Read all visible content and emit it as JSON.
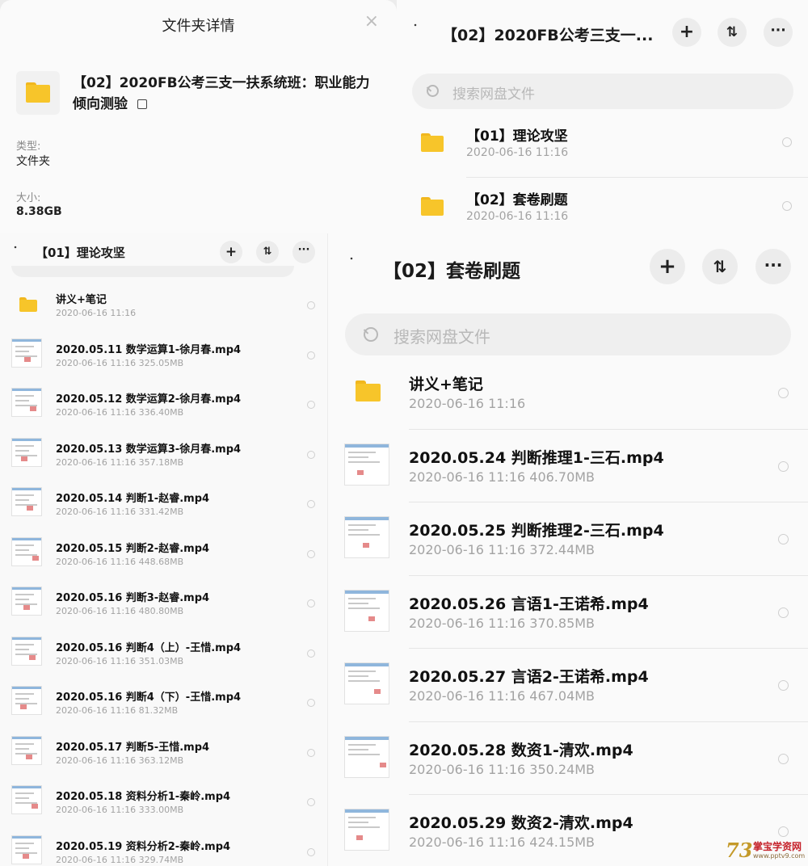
{
  "details": {
    "title": "文件夹详情",
    "close_icon": "close-icon",
    "folder_name": "【02】2020FB公考三支一扶系统班：职业能力倾向测验",
    "type_label": "类型:",
    "type_value": "文件夹",
    "size_label": "大小:",
    "size_value": "8.38GB"
  },
  "root_panel": {
    "title": "【02】2020FB公考三支一...",
    "search_placeholder": "搜索网盘文件",
    "add_label": "+",
    "sort_label": "⇅",
    "more_label": "···",
    "items": [
      {
        "name": "【01】理论攻坚",
        "meta": "2020-06-16  11:16"
      },
      {
        "name": "【02】套卷刷题",
        "meta": "2020-06-16  11:16"
      }
    ]
  },
  "left_panel": {
    "title": "【01】理论攻坚",
    "add_label": "+",
    "sort_label": "⇅",
    "more_label": "···",
    "items": [
      {
        "name": "讲义+笔记",
        "meta": "2020-06-16  11:16",
        "kind": "folder"
      },
      {
        "name": "2020.05.11 数学运算1-徐月春.mp4",
        "meta": "2020-06-16  11:16  325.05MB",
        "kind": "video"
      },
      {
        "name": "2020.05.12 数学运算2-徐月春.mp4",
        "meta": "2020-06-16  11:16  336.40MB",
        "kind": "video"
      },
      {
        "name": "2020.05.13 数学运算3-徐月春.mp4",
        "meta": "2020-06-16  11:16  357.18MB",
        "kind": "video"
      },
      {
        "name": "2020.05.14 判断1-赵睿.mp4",
        "meta": "2020-06-16  11:16  331.42MB",
        "kind": "video"
      },
      {
        "name": "2020.05.15 判断2-赵睿.mp4",
        "meta": "2020-06-16  11:16  448.68MB",
        "kind": "video"
      },
      {
        "name": "2020.05.16 判断3-赵睿.mp4",
        "meta": "2020-06-16  11:16  480.80MB",
        "kind": "video"
      },
      {
        "name": "2020.05.16 判断4（上）-王惜.mp4",
        "meta": "2020-06-16  11:16  351.03MB",
        "kind": "video"
      },
      {
        "name": "2020.05.16 判断4（下）-王惜.mp4",
        "meta": "2020-06-16  11:16  81.32MB",
        "kind": "video"
      },
      {
        "name": "2020.05.17 判断5-王惜.mp4",
        "meta": "2020-06-16  11:16  363.12MB",
        "kind": "video"
      },
      {
        "name": "2020.05.18 资料分析1-秦岭.mp4",
        "meta": "2020-06-16  11:16  333.00MB",
        "kind": "video"
      },
      {
        "name": "2020.05.19 资料分析2-秦岭.mp4",
        "meta": "2020-06-16  11:16  329.74MB",
        "kind": "video"
      }
    ]
  },
  "right_panel": {
    "title": "【02】套卷刷题",
    "search_placeholder": "搜索网盘文件",
    "add_label": "+",
    "sort_label": "⇅",
    "more_label": "···",
    "items": [
      {
        "name": "讲义+笔记",
        "meta": "2020-06-16  11:16",
        "kind": "folder"
      },
      {
        "name": "2020.05.24 判断推理1-三石.mp4",
        "meta": "2020-06-16  11:16  406.70MB",
        "kind": "video"
      },
      {
        "name": "2020.05.25 判断推理2-三石.mp4",
        "meta": "2020-06-16  11:16  372.44MB",
        "kind": "video"
      },
      {
        "name": "2020.05.26 言语1-王诺希.mp4",
        "meta": "2020-06-16  11:16  370.85MB",
        "kind": "video"
      },
      {
        "name": "2020.05.27 言语2-王诺希.mp4",
        "meta": "2020-06-16  11:16  467.04MB",
        "kind": "video"
      },
      {
        "name": "2020.05.28 数资1-清欢.mp4",
        "meta": "2020-06-16  11:16  350.24MB",
        "kind": "video"
      },
      {
        "name": "2020.05.29 数资2-清欢.mp4",
        "meta": "2020-06-16  11:16  424.15MB",
        "kind": "video"
      }
    ]
  },
  "watermark": {
    "mark": "73",
    "text": "掌宝学资网",
    "url": "www.pptv9.com"
  }
}
